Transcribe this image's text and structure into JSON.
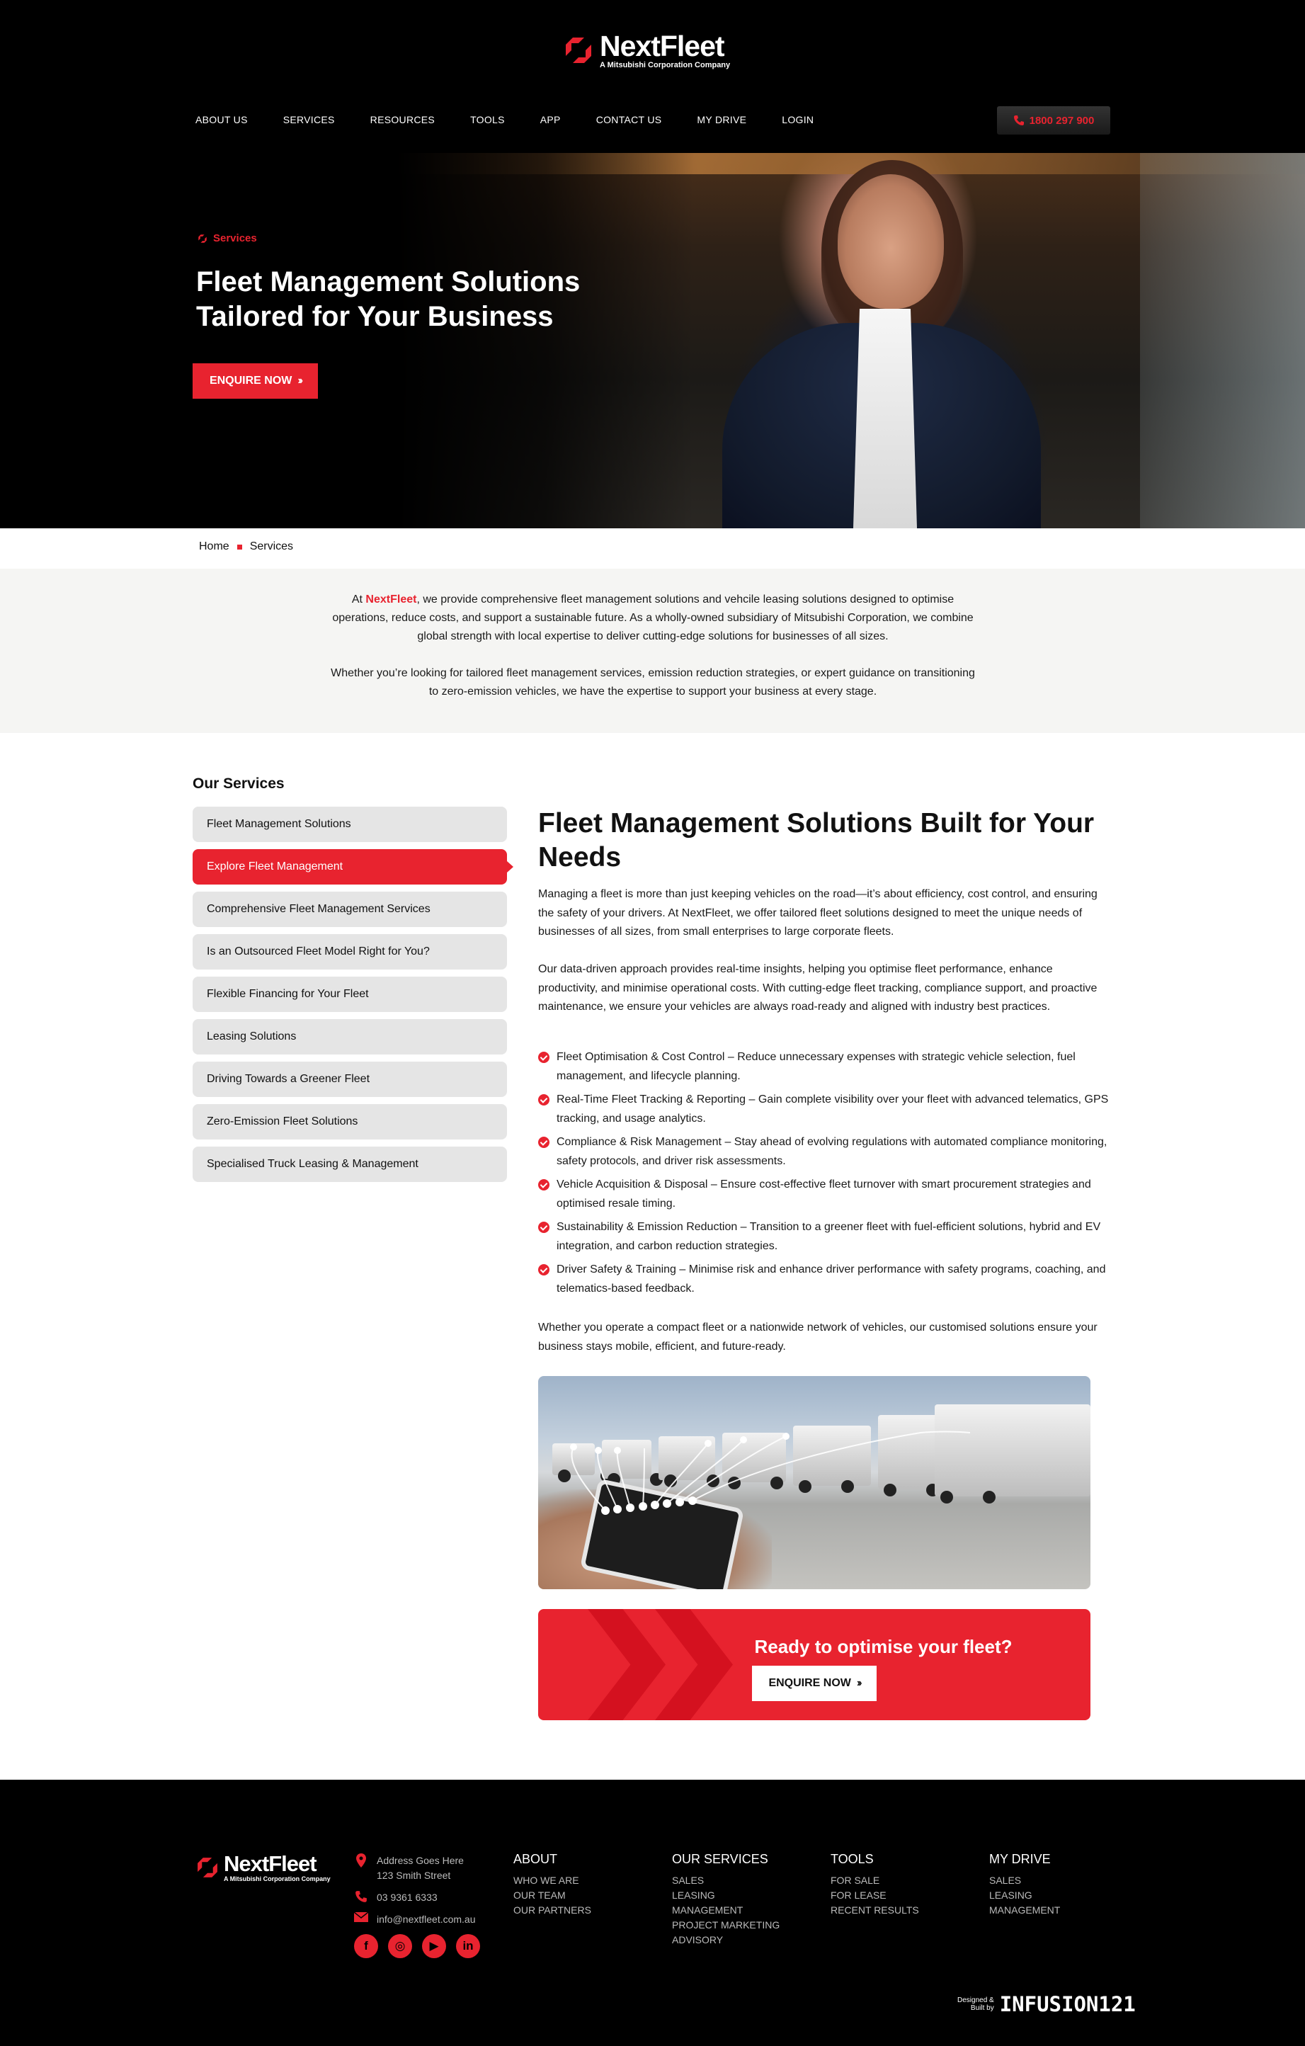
{
  "brand": {
    "name": "NextFleet",
    "tagline": "A Mitsubishi Corporation Company",
    "red": "#e8232f"
  },
  "nav": {
    "items": [
      "ABOUT US",
      "SERVICES",
      "RESOURCES",
      "TOOLS",
      "APP",
      "CONTACT US",
      "MY DRIVE",
      "LOGIN"
    ],
    "phone": "1800 297 900"
  },
  "hero": {
    "tag": "Services",
    "title": "Fleet Management Solutions Tailored for Your Business",
    "button": "ENQUIRE NOW"
  },
  "breadcrumb": {
    "home": "Home",
    "current": "Services"
  },
  "intro": {
    "p1_prefix": "At ",
    "p1_brand": "NextFleet",
    "p1_rest": ", we provide comprehensive fleet management solutions and vehcile leasing solutions designed to optimise operations, reduce costs, and support a sustainable future. As a wholly-owned subsidiary of Mitsubishi Corporation, we combine global strength with local expertise to deliver cutting-edge solutions for businesses of all sizes.",
    "p2": "Whether you’re looking for tailored fleet management services, emission reduction strategies, or expert guidance on transitioning to zero-emission vehicles, we have the expertise to support your business at every stage."
  },
  "sidebar": {
    "heading": "Our Services",
    "items": [
      {
        "label": "Fleet Management Solutions",
        "active": false
      },
      {
        "label": "Explore Fleet Management",
        "active": true
      },
      {
        "label": "Comprehensive Fleet Management Services",
        "active": false
      },
      {
        "label": "Is an Outsourced Fleet Model Right for You?",
        "active": false
      },
      {
        "label": "Flexible Financing for Your Fleet",
        "active": false
      },
      {
        "label": "Leasing Solutions",
        "active": false
      },
      {
        "label": "Driving Towards a Greener Fleet",
        "active": false
      },
      {
        "label": "Zero-Emission Fleet Solutions",
        "active": false
      },
      {
        "label": "Specialised Truck Leasing & Management",
        "active": false
      }
    ]
  },
  "main": {
    "title": "Fleet Management Solutions Built for Your Needs",
    "para1": "Managing a fleet is more than just keeping vehicles on the road—it’s about efficiency, cost control, and ensuring the safety of your drivers. At NextFleet, we offer tailored fleet solutions designed to meet the unique needs of businesses of all sizes, from small enterprises to large corporate fleets.",
    "para2": "Our data-driven approach provides real-time insights, helping you optimise fleet performance, enhance productivity, and minimise operational costs. With cutting-edge fleet tracking, compliance support, and proactive maintenance, we ensure your vehicles are always road-ready and aligned with industry best practices.",
    "features": [
      "Fleet Optimisation & Cost Control – Reduce unnecessary expenses with strategic vehicle selection, fuel management, and lifecycle planning.",
      "Real-Time Fleet Tracking & Reporting – Gain complete visibility over your fleet with advanced telematics, GPS tracking, and usage analytics.",
      "Compliance & Risk Management – Stay ahead of evolving regulations with automated compliance monitoring, safety protocols, and driver risk assessments.",
      "Vehicle Acquisition & Disposal – Ensure cost-effective fleet turnover with smart procurement strategies and optimised resale timing.",
      "Sustainability & Emission Reduction – Transition to a greener fleet with fuel-efficient solutions, hybrid and EV integration, and carbon reduction strategies.",
      "Driver Safety & Training – Minimise risk and enhance driver performance with safety programs, coaching, and telematics-based feedback."
    ],
    "para3": "Whether you operate a compact fleet or a nationwide network of vehicles, our customised solutions ensure your business stays mobile, efficient, and future-ready."
  },
  "cta": {
    "title": "Ready to optimise your fleet?",
    "button": "ENQUIRE NOW"
  },
  "footer": {
    "address_line1": "Address Goes Here",
    "address_line2": "123 Smith Street",
    "phone": "03 9361 6333",
    "email": "info@nextfleet.com.au",
    "socials": [
      "facebook-icon",
      "instagram-icon",
      "youtube-icon",
      "linkedin-icon"
    ],
    "columns": [
      {
        "heading": "ABOUT",
        "links": [
          "WHO WE ARE",
          "OUR TEAM",
          "OUR PARTNERS"
        ]
      },
      {
        "heading": "OUR SERVICES",
        "links": [
          "SALES",
          "LEASING",
          "MANAGEMENT",
          "PROJECT MARKETING",
          "ADVISORY"
        ]
      },
      {
        "heading": "TOOLS",
        "links": [
          "FOR SALE",
          "FOR LEASE",
          "RECENT RESULTS"
        ]
      },
      {
        "heading": "MY DRIVE",
        "links": [
          "SALES",
          "LEASING",
          "MANAGEMENT"
        ]
      }
    ],
    "built_small_1": "Designed &",
    "built_small_2": "Built by",
    "built_by": "INFUSION121"
  }
}
